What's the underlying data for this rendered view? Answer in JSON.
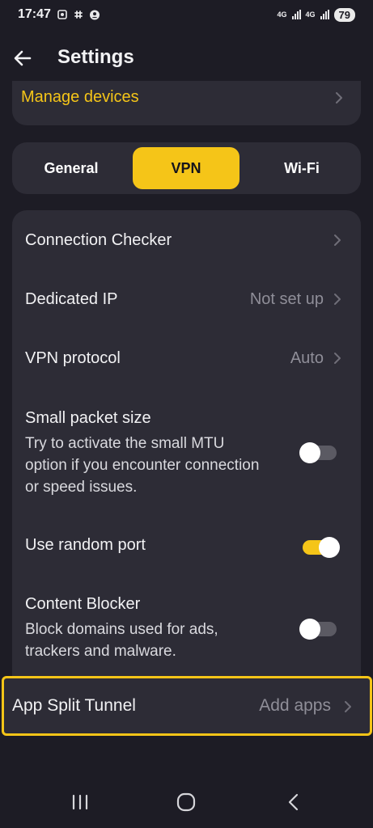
{
  "status_bar": {
    "time": "17:47",
    "network_1": "4G",
    "network_2": "4G",
    "battery": "79"
  },
  "header": {
    "title": "Settings"
  },
  "manage_devices": {
    "label": "Manage devices"
  },
  "tabs": [
    {
      "label": "General",
      "active": false
    },
    {
      "label": "VPN",
      "active": true
    },
    {
      "label": "Wi-Fi",
      "active": false
    }
  ],
  "settings": {
    "connection_checker": {
      "label": "Connection Checker"
    },
    "dedicated_ip": {
      "label": "Dedicated IP",
      "value": "Not set up"
    },
    "vpn_protocol": {
      "label": "VPN protocol",
      "value": "Auto"
    },
    "small_packet": {
      "label": "Small packet size",
      "description": "Try to activate the small MTU option if you encounter connection or speed issues.",
      "enabled": false
    },
    "random_port": {
      "label": "Use random port",
      "enabled": true
    },
    "content_blocker": {
      "label": "Content Blocker",
      "description": "Block domains used for ads, trackers and malware.",
      "enabled": false
    },
    "app_split_tunnel": {
      "label": "App Split Tunnel",
      "value": "Add apps"
    }
  },
  "colors": {
    "accent": "#f5c518",
    "background": "#1d1c25",
    "card": "#2d2c36",
    "muted_text": "#8f8e98"
  },
  "icons": {
    "back": "arrow-left-icon",
    "chevron": "chevron-right-icon",
    "nav_recents": "recents-icon",
    "nav_home": "home-icon",
    "nav_back": "nav-back-icon"
  }
}
